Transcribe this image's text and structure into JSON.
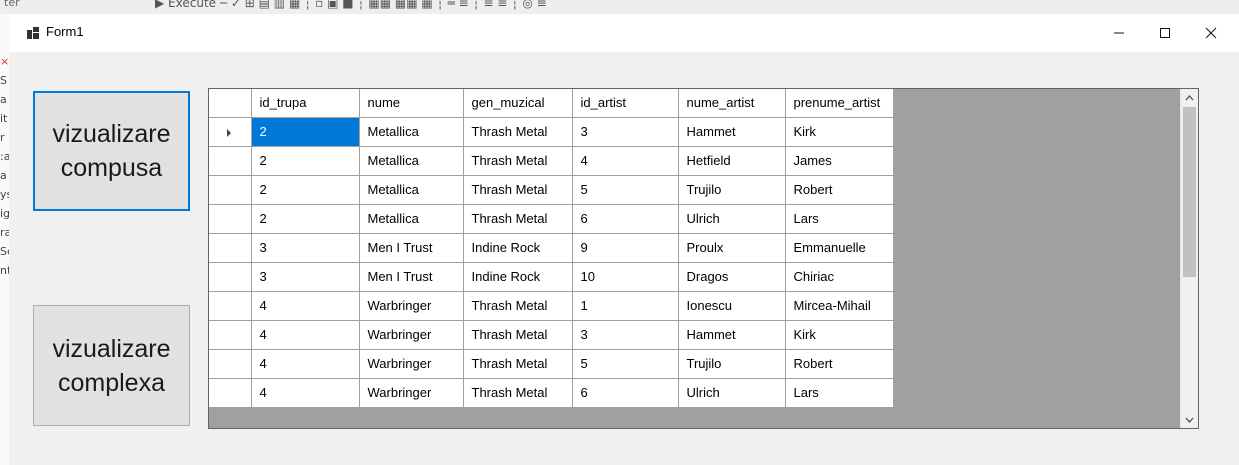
{
  "window": {
    "title": "Form1"
  },
  "background": {
    "ide_fragment": "Execute",
    "left_fragment": "ter"
  },
  "buttons": {
    "compusa": "vizualizare compusa",
    "complexa": "vizualizare complexa"
  },
  "grid": {
    "columns": [
      "id_trupa",
      "nume",
      "gen_muzical",
      "id_artist",
      "nume_artist",
      "prenume_artist"
    ],
    "rows": [
      [
        "2",
        "Metallica",
        "Thrash Metal",
        "3",
        "Hammet",
        "Kirk"
      ],
      [
        "2",
        "Metallica",
        "Thrash Metal",
        "4",
        "Hetfield",
        "James"
      ],
      [
        "2",
        "Metallica",
        "Thrash Metal",
        "5",
        "Trujilo",
        "Robert"
      ],
      [
        "2",
        "Metallica",
        "Thrash Metal",
        "6",
        "Ulrich",
        "Lars"
      ],
      [
        "3",
        "Men I Trust",
        "Indine Rock",
        "9",
        "Proulx",
        "Emmanuelle"
      ],
      [
        "3",
        "Men I Trust",
        "Indine Rock",
        "10",
        "Dragos",
        "Chiriac"
      ],
      [
        "4",
        "Warbringer",
        "Thrash Metal",
        "1",
        "Ionescu",
        "Mircea-Mihail"
      ],
      [
        "4",
        "Warbringer",
        "Thrash Metal",
        "3",
        "Hammet",
        "Kirk"
      ],
      [
        "4",
        "Warbringer",
        "Thrash Metal",
        "5",
        "Trujilo",
        "Robert"
      ],
      [
        "4",
        "Warbringer",
        "Thrash Metal",
        "6",
        "Ulrich",
        "Lars"
      ]
    ],
    "selected_row": 0,
    "selected_col": 0
  },
  "colors": {
    "accent": "#0078d7",
    "grid_background": "#a0a0a0"
  }
}
